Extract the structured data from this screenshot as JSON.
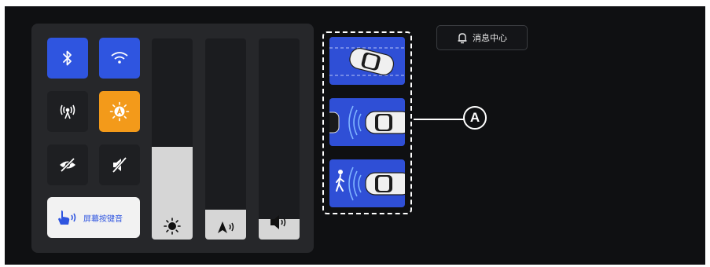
{
  "control_panel": {
    "touch_sound_label": "屏幕按键音",
    "brightness_level": 0.46,
    "navigation_volume_level": 0.15,
    "media_volume_level": 0.0
  },
  "message_center": {
    "label": "消息中心"
  },
  "callout": {
    "label": "A"
  },
  "icons": [
    "bluetooth-icon",
    "wifi-icon",
    "hotspot-icon",
    "auto-brightness-icon",
    "privacy-hidden-icon",
    "mute-icon",
    "touch-sound-icon",
    "brightness-icon",
    "navigation-volume-icon",
    "media-volume-icon",
    "bell-icon"
  ],
  "colors": {
    "accent_blue": "#2f55e0",
    "accent_orange": "#f39a1a",
    "background": "#0f1012"
  }
}
